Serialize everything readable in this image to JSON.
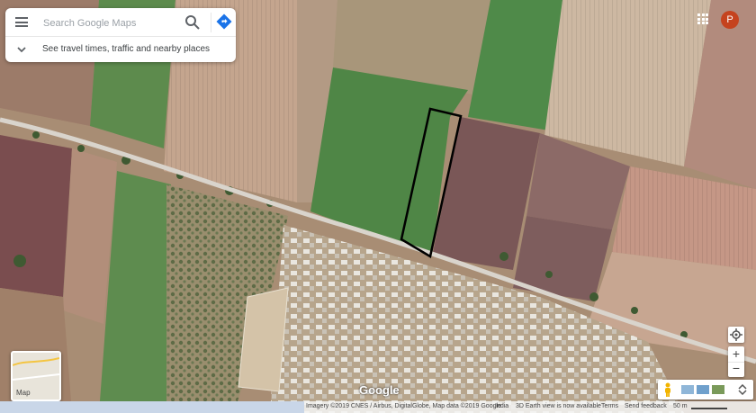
{
  "search": {
    "placeholder": "Search Google Maps",
    "travel_text": "See travel times, traffic and nearby places"
  },
  "account": {
    "initial": "P"
  },
  "layer": {
    "label": "Map"
  },
  "logo": "Google",
  "footer": {
    "imagery": "Imagery ©2019 CNES / Airbus, DigitalGlobe, Map data ©2019 Google",
    "country": "India",
    "street_view": "3D Earth view is now available",
    "terms": "Terms",
    "feedback": "Send feedback",
    "scale": "50 m"
  },
  "colors": {
    "accent": "#1a73e8",
    "avatar": "#c5431e"
  }
}
